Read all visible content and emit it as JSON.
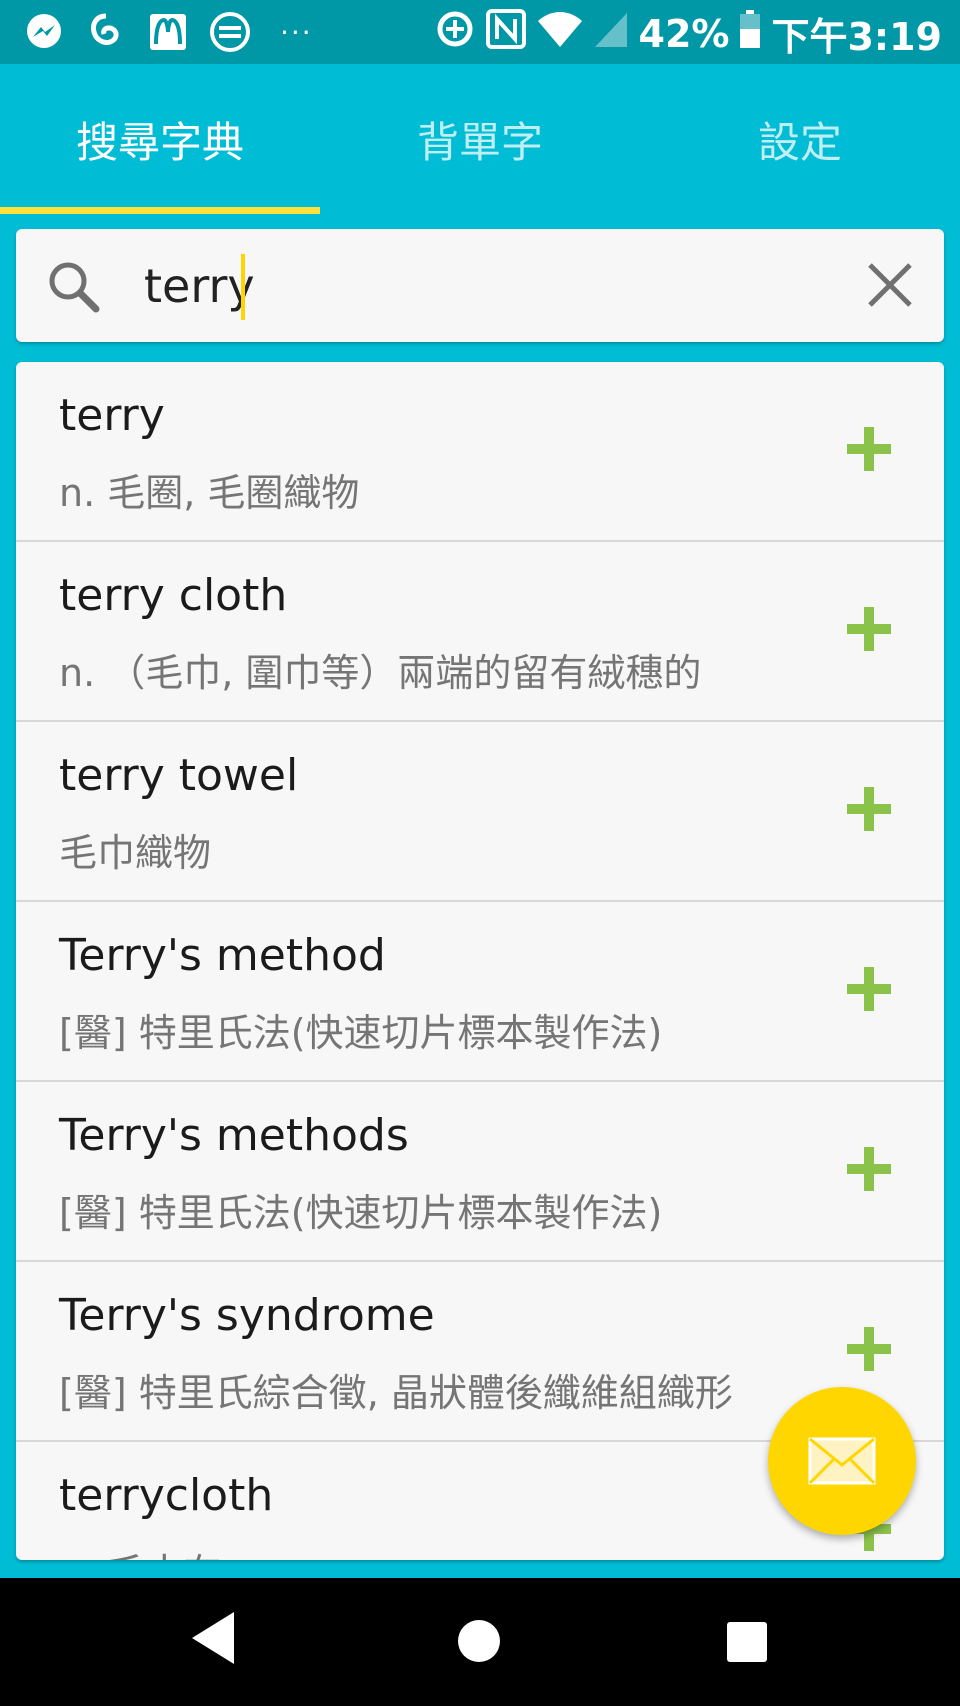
{
  "status_bar": {
    "battery": "42%",
    "time": "下午3:19",
    "more": "···",
    "icons": [
      "messenger-icon",
      "app-icon",
      "mcdonalds-icon",
      "transit-icon",
      "data-saver-icon",
      "nfc-icon",
      "wifi-icon",
      "signal-icon",
      "battery-icon"
    ]
  },
  "tabs": [
    {
      "label": "搜尋字典"
    },
    {
      "label": "背單字"
    },
    {
      "label": "設定"
    }
  ],
  "search": {
    "value": "terry"
  },
  "results": [
    {
      "word": "terry",
      "definition": "n. 毛圈, 毛圈織物"
    },
    {
      "word": "terry cloth",
      "definition": "n. （毛巾, 圍巾等）兩端的留有絨穗的"
    },
    {
      "word": "terry towel",
      "definition": " 毛巾織物"
    },
    {
      "word": "Terry's method",
      "definition": "[醫] 特里氏法(快速切片標本製作法)"
    },
    {
      "word": "Terry's methods",
      "definition": "[醫] 特里氏法(快速切片標本製作法)"
    },
    {
      "word": "Terry's syndrome",
      "definition": "[醫] 特里氏綜合徵, 晶狀體後纖維組織形"
    },
    {
      "word": "terrycloth",
      "definition": "n. 毛巾布"
    }
  ],
  "colors": {
    "primary": "#00BCD4",
    "status": "#0097A7",
    "indicator": "#FFE13B",
    "add": "#8BC34A",
    "fab": "#FFD600"
  }
}
